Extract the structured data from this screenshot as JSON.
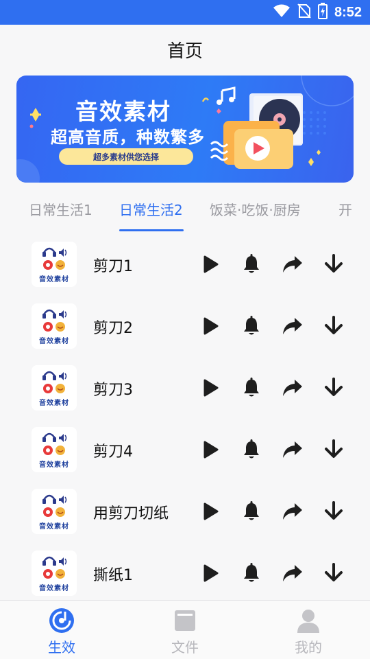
{
  "status_bar": {
    "time": "8:52"
  },
  "header": {
    "title": "首页"
  },
  "banner": {
    "title": "音效素材",
    "subtitle": "超高音质，种数繁多",
    "pill_text": "超多素材供您选择"
  },
  "tabs": [
    {
      "label": "日常生活1",
      "active": false
    },
    {
      "label": "日常生活2",
      "active": true
    },
    {
      "label": "饭菜·吃饭·厨房",
      "active": false
    },
    {
      "label": "开",
      "active": false
    }
  ],
  "thumbnail_caption": "音效素材",
  "sounds": [
    {
      "name": "剪刀1"
    },
    {
      "name": "剪刀2"
    },
    {
      "name": "剪刀3"
    },
    {
      "name": "剪刀4"
    },
    {
      "name": "用剪刀切纸"
    },
    {
      "name": "撕纸1"
    }
  ],
  "actions": [
    "play-icon",
    "bell-icon",
    "share-icon",
    "download-icon"
  ],
  "bottom_nav": [
    {
      "label": "生效",
      "icon": "disc-icon",
      "active": true
    },
    {
      "label": "文件",
      "icon": "folder-icon",
      "active": false
    },
    {
      "label": "我的",
      "icon": "user-icon",
      "active": false
    }
  ],
  "colors": {
    "accent": "#2f6ff0",
    "inactive": "#b7b7bc",
    "banner_blue": "#3566f2",
    "pill_yellow": "#fce79a"
  }
}
